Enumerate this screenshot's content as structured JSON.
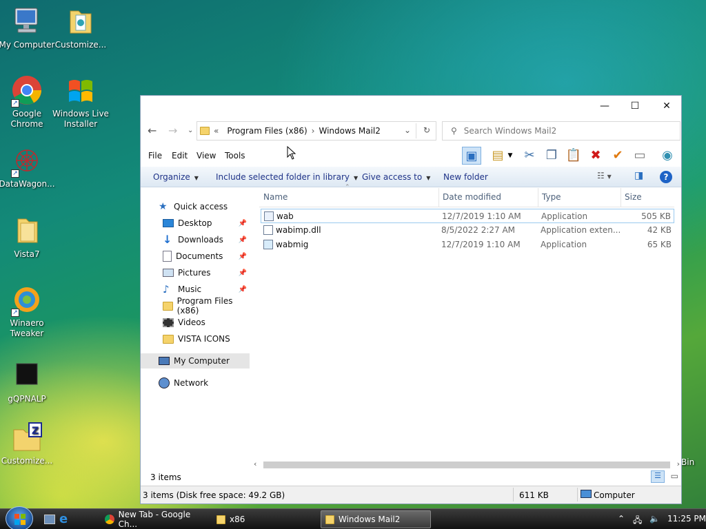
{
  "desktop": {
    "icons": [
      {
        "label": "My Computer",
        "icon": "computer-icon"
      },
      {
        "label": "Customize...",
        "icon": "folder-icon"
      },
      {
        "label": "Google Chrome",
        "icon": "chrome-icon"
      },
      {
        "label": "Windows Live Installer",
        "icon": "windows-flag-icon"
      },
      {
        "label": "DataWagon...",
        "icon": "datawagon-icon"
      },
      {
        "label": "Vista7",
        "icon": "folder-icon"
      },
      {
        "label": "Winaero Tweaker",
        "icon": "winaero-icon"
      },
      {
        "label": "gQPNALP",
        "icon": "black-square-icon"
      },
      {
        "label": "Customize...",
        "icon": "zip-folder-icon"
      },
      {
        "label": "Bin",
        "icon": "recycle-bin-icon"
      }
    ]
  },
  "window": {
    "address": {
      "prefix": "«",
      "segments": [
        "Program Files (x86)",
        "Windows Mail2"
      ]
    },
    "search_placeholder": "Search Windows Mail2",
    "menu": [
      "File",
      "Edit",
      "View",
      "Tools"
    ],
    "commands": {
      "organize": "Organize",
      "include": "Include selected folder in library",
      "give_access": "Give access to",
      "new_folder": "New folder"
    },
    "nav": {
      "quick_access": "Quick access",
      "items": [
        {
          "label": "Desktop",
          "pinned": true
        },
        {
          "label": "Downloads",
          "pinned": true
        },
        {
          "label": "Documents",
          "pinned": true
        },
        {
          "label": "Pictures",
          "pinned": true
        },
        {
          "label": "Music",
          "pinned": true
        },
        {
          "label": "Program Files (x86)",
          "pinned": false
        },
        {
          "label": "Videos",
          "pinned": false
        },
        {
          "label": "VISTA ICONS",
          "pinned": false
        }
      ],
      "my_computer": "My Computer",
      "network": "Network"
    },
    "columns": {
      "name": "Name",
      "date": "Date modified",
      "type": "Type",
      "size": "Size"
    },
    "files": [
      {
        "name": "wab",
        "date": "12/7/2019 1:10 AM",
        "type": "Application",
        "size": "505 KB"
      },
      {
        "name": "wabimp.dll",
        "date": "8/5/2022 2:27 AM",
        "type": "Application exten...",
        "size": "42 KB"
      },
      {
        "name": "wabmig",
        "date": "12/7/2019 1:10 AM",
        "type": "Application",
        "size": "65 KB"
      }
    ],
    "item_count": "3 items",
    "status": {
      "left": "3 items (Disk free space: 49.2 GB)",
      "size": "611 KB",
      "location": "Computer"
    }
  },
  "taskbar": {
    "tasks": [
      {
        "label": "New Tab - Google Ch...",
        "active": false
      },
      {
        "label": "x86",
        "active": false
      },
      {
        "label": "Windows Mail2",
        "active": true
      }
    ],
    "clock": "11:25 PM"
  }
}
